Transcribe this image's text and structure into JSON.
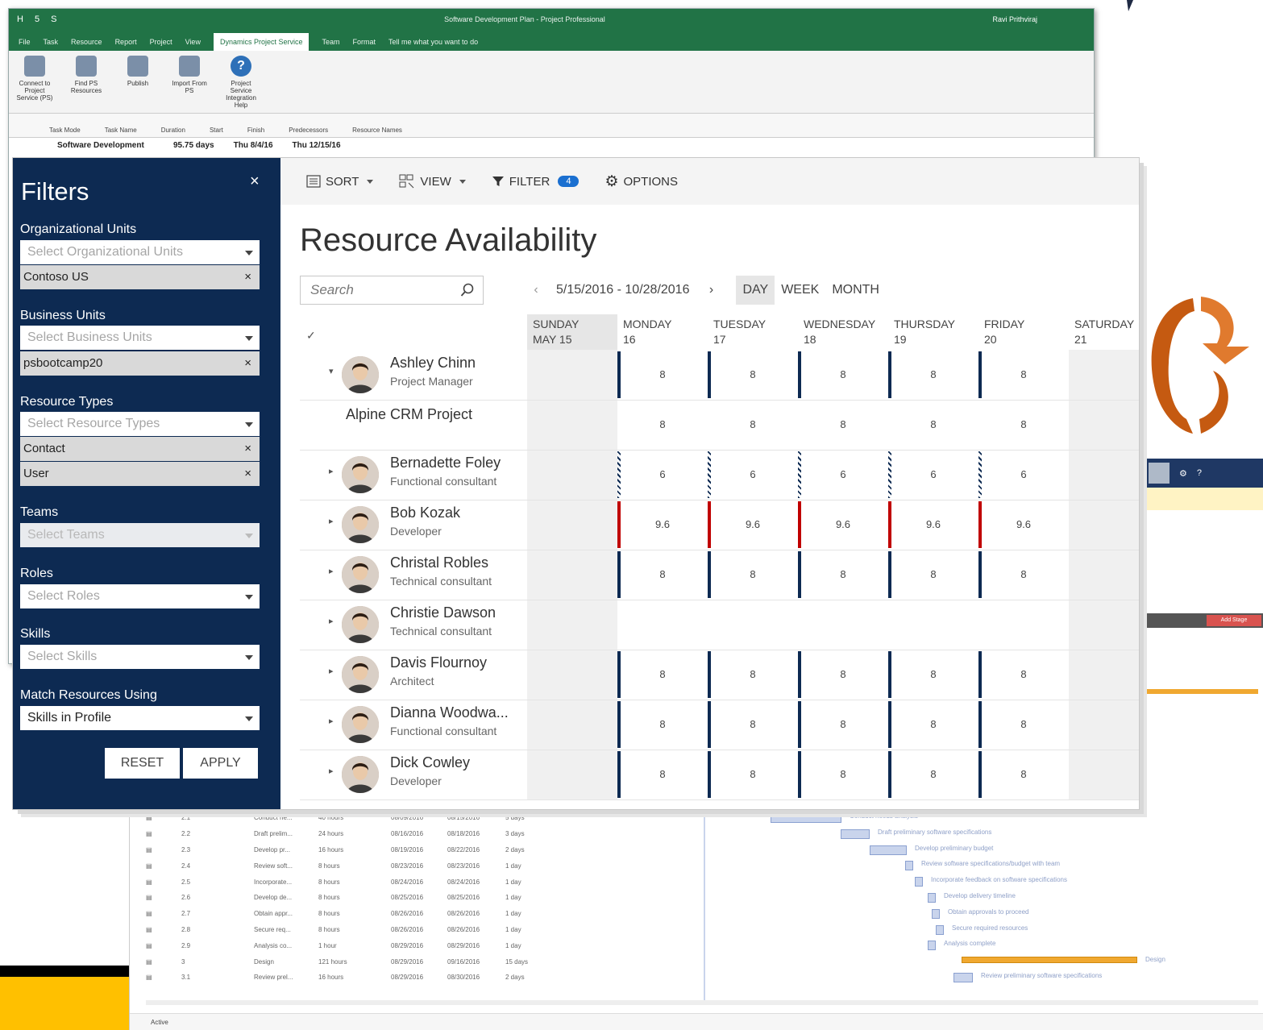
{
  "project_window": {
    "quick_access": [
      "H",
      "5",
      "S"
    ],
    "title": "Software Development Plan - Project Professional",
    "user": "Ravi Prithviraj",
    "tabs": [
      "File",
      "Task",
      "Resource",
      "Report",
      "Project",
      "View",
      "Dynamics Project Service",
      "Team",
      "Format"
    ],
    "active_tab": "Dynamics Project Service",
    "tell_me": "Tell me what you want to do",
    "ribbon_buttons": [
      "Connect to Project Service (PS)",
      "Find PS Resources",
      "Publish",
      "Import From PS",
      "Project Service Integration Help"
    ],
    "gantt_columns": [
      "Task Mode",
      "Task Name",
      "Duration",
      "Start",
      "Finish",
      "Predecessors",
      "Resource Names"
    ],
    "task": {
      "name": "Software Development",
      "duration": "95.75 days",
      "start": "Thu 8/4/16",
      "finish": "Thu 12/15/16"
    }
  },
  "web_window": {
    "status": "Active",
    "add_stage": "Add Stage",
    "rows": [
      {
        "id": "2.1",
        "name": "Conduct ne...",
        "work": "40 hours",
        "start": "08/09/2016",
        "finish": "08/15/2016",
        "dur": "5 days"
      },
      {
        "id": "2.2",
        "name": "Draft prelim...",
        "work": "24 hours",
        "start": "08/16/2016",
        "finish": "08/18/2016",
        "dur": "3 days"
      },
      {
        "id": "2.3",
        "name": "Develop pr...",
        "work": "16 hours",
        "start": "08/19/2016",
        "finish": "08/22/2016",
        "dur": "2 days"
      },
      {
        "id": "2.4",
        "name": "Review soft...",
        "work": "8 hours",
        "start": "08/23/2016",
        "finish": "08/23/2016",
        "dur": "1 day"
      },
      {
        "id": "2.5",
        "name": "Incorporate...",
        "work": "8 hours",
        "start": "08/24/2016",
        "finish": "08/24/2016",
        "dur": "1 day"
      },
      {
        "id": "2.6",
        "name": "Develop de...",
        "work": "8 hours",
        "start": "08/25/2016",
        "finish": "08/25/2016",
        "dur": "1 day"
      },
      {
        "id": "2.7",
        "name": "Obtain appr...",
        "work": "8 hours",
        "start": "08/26/2016",
        "finish": "08/26/2016",
        "dur": "1 day"
      },
      {
        "id": "2.8",
        "name": "Secure req...",
        "work": "8 hours",
        "start": "08/26/2016",
        "finish": "08/26/2016",
        "dur": "1 day"
      },
      {
        "id": "2.9",
        "name": "Analysis co...",
        "work": "1 hour",
        "start": "08/29/2016",
        "finish": "08/29/2016",
        "dur": "1 day"
      },
      {
        "id": "3",
        "name": "Design",
        "work": "121 hours",
        "start": "08/29/2016",
        "finish": "09/16/2016",
        "dur": "15 days"
      },
      {
        "id": "3.1",
        "name": "Review prel...",
        "work": "16 hours",
        "start": "08/29/2016",
        "finish": "08/30/2016",
        "dur": "2 days"
      }
    ],
    "bar_labels": [
      "Conduct needs analysis",
      "Draft preliminary software specifications",
      "Develop preliminary budget",
      "Review software specifications/budget with team",
      "Incorporate feedback on software specifications",
      "Develop delivery timeline",
      "Obtain approvals to proceed",
      "Secure required resources",
      "Analysis complete",
      "Design",
      "Review preliminary software specifications"
    ]
  },
  "filters": {
    "title": "Filters",
    "close": "×",
    "org_units": {
      "label": "Organizational Units",
      "placeholder": "Select Organizational Units",
      "chips": [
        "Contoso US"
      ]
    },
    "business_units": {
      "label": "Business Units",
      "placeholder": "Select Business Units",
      "chips": [
        "psbootcamp20"
      ]
    },
    "resource_types": {
      "label": "Resource Types",
      "placeholder": "Select Resource Types",
      "chips": [
        "Contact",
        "User"
      ]
    },
    "teams": {
      "label": "Teams",
      "placeholder": "Select Teams"
    },
    "roles": {
      "label": "Roles",
      "placeholder": "Select Roles"
    },
    "skills": {
      "label": "Skills",
      "placeholder": "Select Skills"
    },
    "match": {
      "label": "Match Resources Using",
      "value": "Skills in Profile"
    },
    "reset": "RESET",
    "apply": "APPLY"
  },
  "toolbar": {
    "sort": "SORT",
    "view": "VIEW",
    "filter": "FILTER",
    "filter_count": "4",
    "options": "OPTIONS"
  },
  "main": {
    "title": "Resource Availability",
    "search_placeholder": "Search",
    "date_range": "5/15/2016 - 10/28/2016",
    "prev": "‹",
    "next": "›",
    "views": [
      "DAY",
      "WEEK",
      "MONTH"
    ],
    "active_view": "DAY"
  },
  "days": [
    {
      "name": "SUNDAY",
      "date": "MAY 15"
    },
    {
      "name": "MONDAY",
      "date": "16"
    },
    {
      "name": "TUESDAY",
      "date": "17"
    },
    {
      "name": "WEDNESDAY",
      "date": "18"
    },
    {
      "name": "THURSDAY",
      "date": "19"
    },
    {
      "name": "FRIDAY",
      "date": "20"
    },
    {
      "name": "SATURDAY",
      "date": "21"
    }
  ],
  "resources": [
    {
      "name": "Ashley Chinn",
      "role": "Project Manager",
      "hours": [
        "8",
        "8",
        "8",
        "8",
        "8"
      ],
      "mark": "blue",
      "expanded": true
    },
    {
      "name": "Alpine CRM Project",
      "role": "",
      "hours": [
        "8",
        "8",
        "8",
        "8",
        "8"
      ],
      "mark": "none",
      "sub": true
    },
    {
      "name": "Bernadette Foley",
      "role": "Functional consultant",
      "hours": [
        "6",
        "6",
        "6",
        "6",
        "6"
      ],
      "mark": "hatch"
    },
    {
      "name": "Bob Kozak",
      "role": "Developer",
      "hours": [
        "9.6",
        "9.6",
        "9.6",
        "9.6",
        "9.6"
      ],
      "mark": "red"
    },
    {
      "name": "Christal Robles",
      "role": "Technical consultant",
      "hours": [
        "8",
        "8",
        "8",
        "8",
        "8"
      ],
      "mark": "blue"
    },
    {
      "name": "Christie Dawson",
      "role": "Technical consultant",
      "hours": [
        "",
        "",
        "",
        "",
        ""
      ],
      "mark": "none"
    },
    {
      "name": "Davis Flournoy",
      "role": "Architect",
      "hours": [
        "8",
        "8",
        "8",
        "8",
        "8"
      ],
      "mark": "blue"
    },
    {
      "name": "Dianna Woodwa...",
      "role": "Functional consultant",
      "hours": [
        "8",
        "8",
        "8",
        "8",
        "8"
      ],
      "mark": "blue"
    },
    {
      "name": "Dick Cowley",
      "role": "Developer",
      "hours": [
        "8",
        "8",
        "8",
        "8",
        "8"
      ],
      "mark": "blue"
    }
  ],
  "colors": {
    "filters_bg": "#0d2a52",
    "over": "#c00000",
    "brand_accent": "#217346",
    "badge": "#1a6fd0",
    "decor_orange": "#e07a2e"
  }
}
